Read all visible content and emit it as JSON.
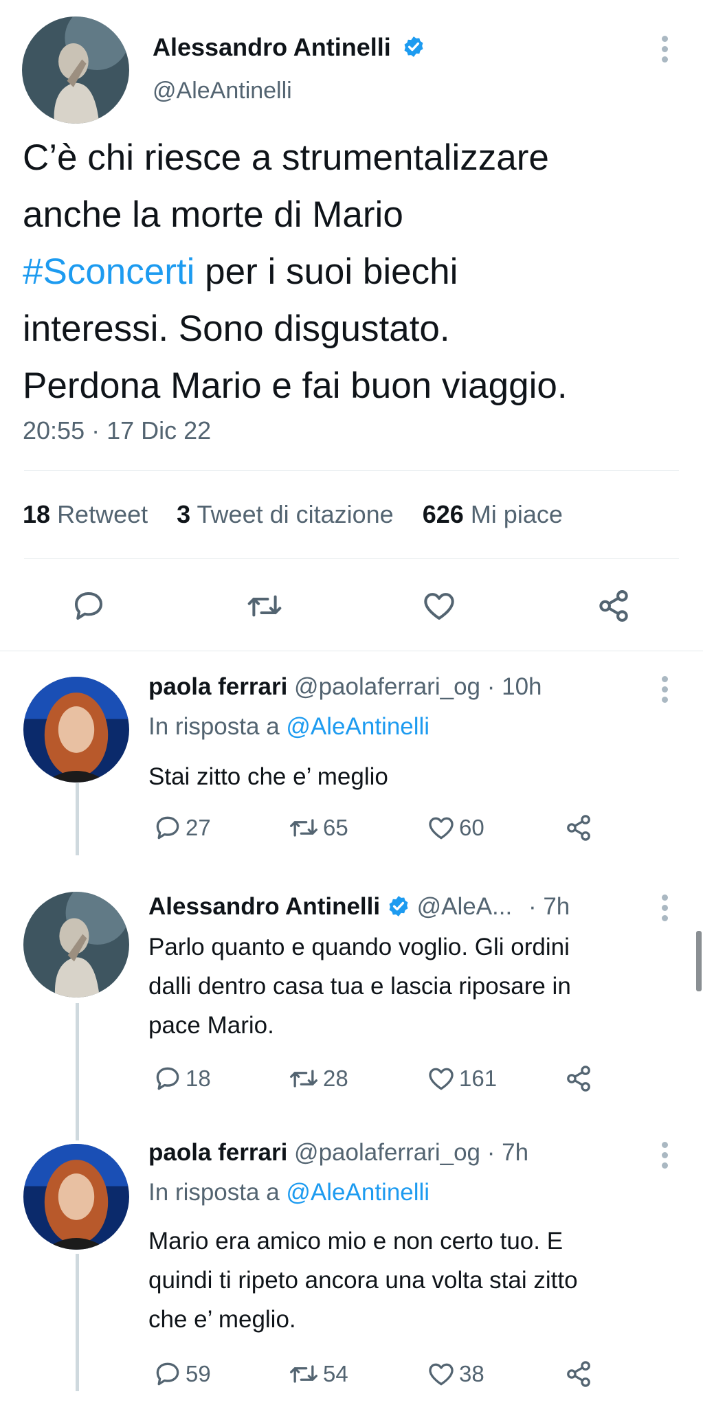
{
  "main_tweet": {
    "author_name": "Alessandro Antinelli",
    "handle": "@AleAntinelli",
    "text_lines": [
      "C’è chi riesce a strumentalizzare",
      "anche la morte di Mario"
    ],
    "hashtag": "#Sconcerti",
    "line3_rest": " per i suoi biechi",
    "line4": "interessi. Sono disgustato.",
    "line5": "Perdona Mario e fai buon viaggio.",
    "timestamp": "20:55 · 17 Dic 22",
    "stats": {
      "retweets_count": "18",
      "retweets_label": "Retweet",
      "quotes_count": "3",
      "quotes_label": "Tweet di citazione",
      "likes_count": "626",
      "likes_label": "Mi piace"
    }
  },
  "replies": [
    {
      "author_name": "paola ferrari",
      "handle": "@paolaferrari_og",
      "time": "· 10h",
      "reply_prefix": "In risposta a",
      "reply_to": "@AleAntinelli",
      "text_lines": [
        "Stai zitto che e’ meglio"
      ],
      "replies": "27",
      "retweets": "65",
      "likes": "60"
    },
    {
      "author_name": "Alessandro Antinelli",
      "handle": "@AleA...",
      "time": "· 7h",
      "text_lines": [
        "Parlo quanto e quando voglio. Gli ordini",
        "dalli dentro casa tua e lascia riposare in",
        "pace Mario."
      ],
      "replies": "18",
      "retweets": "28",
      "likes": "161"
    },
    {
      "author_name": "paola ferrari",
      "handle": "@paolaferrari_og",
      "time": "· 7h",
      "reply_prefix": "In risposta a",
      "reply_to": "@AleAntinelli",
      "text_lines": [
        "Mario era amico mio e non certo tuo. E",
        "quindi ti ripeto ancora una volta stai zitto",
        "che e’ meglio."
      ],
      "replies": "59",
      "retweets": "54",
      "likes": "38"
    }
  ],
  "colors": {
    "accent": "#1d9bf0",
    "text": "#0f1419",
    "secondary": "#536471"
  }
}
